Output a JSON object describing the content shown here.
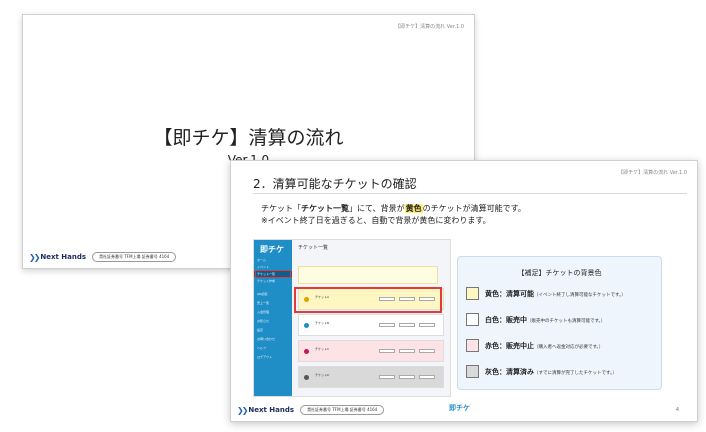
{
  "back_slide": {
    "corner": "【即チケ】清算の流れ Ver.1.0",
    "title": "【即チケ】清算の流れ",
    "version": "Ver.1.0",
    "brand": "Next Hands",
    "pill": "貴社証券番号 TFM上場 証券番号 4164"
  },
  "front_slide": {
    "corner": "【即チケ】清算の流れ Ver.1.0",
    "heading": "2．清算可能なチケットの確認",
    "desc_line1_pre": "チケット「",
    "desc_line1_bold": "チケット一覧",
    "desc_line1_mid": "」にて、背景が",
    "desc_line1_yellow": "黄色",
    "desc_line1_post": "のチケットが清算可能です。",
    "desc_line2": "※イベント終了日を過ぎると、自動で背景が黄色に変わります。",
    "brand": "Next Hands",
    "pill": "貴社証券番号 TFM上場 証券番号 4164",
    "footer_logo": "即チケ",
    "page_number": "4"
  },
  "mini_app": {
    "logo": "即チケ",
    "title": "チケット一覧",
    "nav": [
      "ホーム",
      "イベント",
      "チケット一覧",
      "チケット作成",
      "QR読取",
      "売上一覧",
      "入金管理",
      "お知らせ",
      "設定",
      "お問い合わせ",
      "ヘルプ",
      "ログアウト"
    ],
    "cards": [
      {
        "name": "チケットA",
        "color": "yellow"
      },
      {
        "name": "チケットB",
        "color": "white"
      },
      {
        "name": "チケットC",
        "color": "pink"
      },
      {
        "name": "チケットD",
        "color": "gray"
      }
    ]
  },
  "legend": {
    "title": "【補足】チケットの背景色",
    "items": [
      {
        "label": "黄色：清算可能",
        "note": "（イベント終了し清算可能なチケットです。）",
        "color": "#fff7c2"
      },
      {
        "label": "白色：販売中",
        "note": "（販売中のチケットも清算可能です。）",
        "color": "#ffffff"
      },
      {
        "label": "赤色：販売中止",
        "note": "（購入者へ返金対応が必要です。）",
        "color": "#fde3e6"
      },
      {
        "label": "灰色：清算済み",
        "note": "（すでに清算が完了したチケットです。）",
        "color": "#d9d9d9"
      }
    ]
  }
}
